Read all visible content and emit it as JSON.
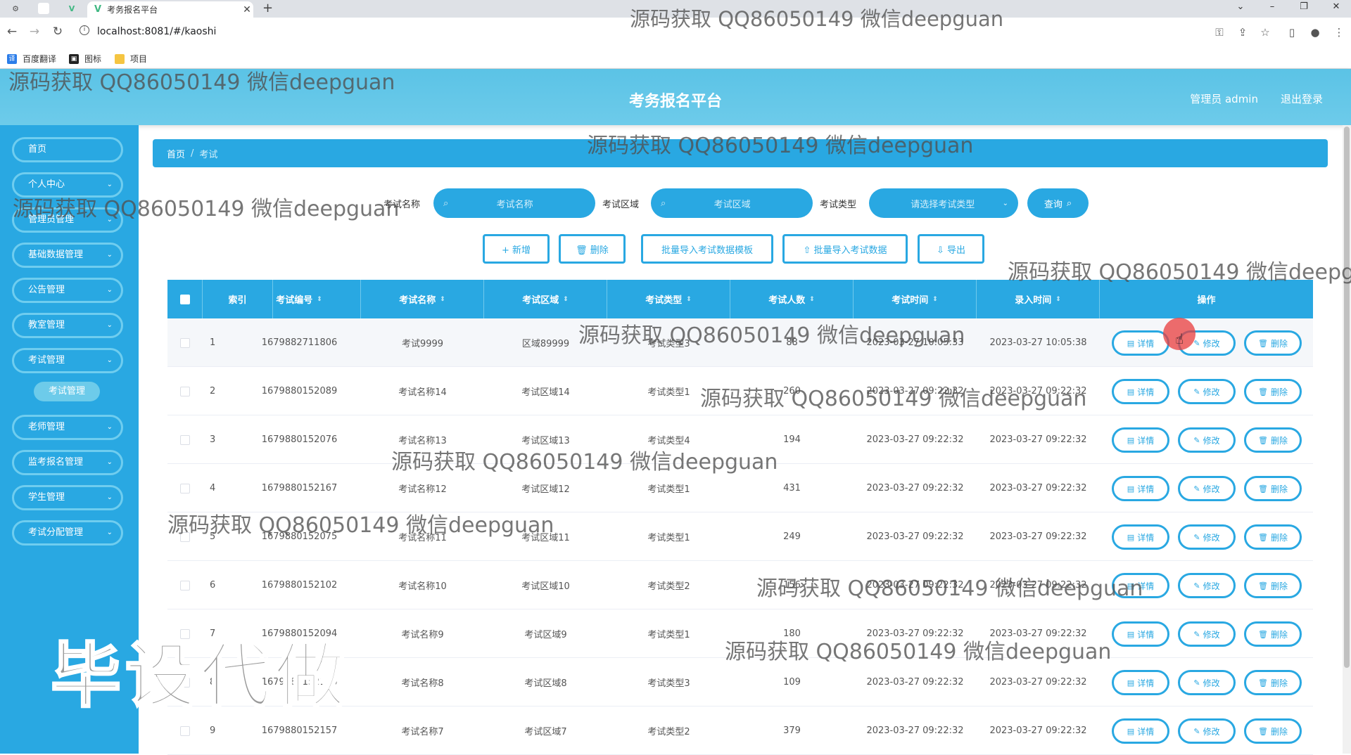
{
  "browser": {
    "tab_title": "考务报名平台",
    "tab_close": "✕",
    "new_tab": "+",
    "url": "localhost:8081/#/kaoshi",
    "bookmarks": [
      "百度翻译",
      "图标",
      "项目"
    ]
  },
  "header": {
    "title": "考务报名平台",
    "user": "管理员 admin",
    "logout": "退出登录"
  },
  "sidebar": {
    "items": [
      {
        "label": "首页"
      },
      {
        "label": "个人中心"
      },
      {
        "label": "管理员管理"
      },
      {
        "label": "基础数据管理"
      },
      {
        "label": "公告管理"
      },
      {
        "label": "教室管理"
      },
      {
        "label": "考试管理"
      },
      {
        "label": "老师管理"
      },
      {
        "label": "监考报名管理"
      },
      {
        "label": "学生管理"
      },
      {
        "label": "考试分配管理"
      }
    ],
    "subitem": "考试管理",
    "chevron": "⌄"
  },
  "breadcrumb": {
    "home": "首页",
    "sep": "/",
    "current": "考试"
  },
  "search": {
    "name_label": "考试名称",
    "name_placeholder": "考试名称",
    "area_label": "考试区域",
    "area_placeholder": "考试区域",
    "type_label": "考试类型",
    "type_placeholder": "请选择考试类型",
    "query": "查询"
  },
  "actions": {
    "add": "+ 新增",
    "delete": "🗑 删除",
    "import_template": "批量导入考试数据模板",
    "import_data": "⇧ 批量导入考试数据",
    "export": "⇩ 导出"
  },
  "table": {
    "headers": [
      "索引",
      "考试编号",
      "考试名称",
      "考试区域",
      "考试类型",
      "考试人数",
      "考试时间",
      "录入时间",
      "操作"
    ],
    "sort_icon": "⇕",
    "btn_detail": "详情",
    "btn_edit": "修改",
    "btn_delete": "删除",
    "rows": [
      {
        "idx": "1",
        "code": "1679882711806",
        "name": "考试9999",
        "area": "区域89999",
        "type": "考试类型3",
        "count": "88",
        "time": "2023-03-27 10:05:33",
        "created": "2023-03-27 10:05:38"
      },
      {
        "idx": "2",
        "code": "1679880152089",
        "name": "考试名称14",
        "area": "考试区域14",
        "type": "考试类型1",
        "count": "260",
        "time": "2023-03-27 09:22:32",
        "created": "2023-03-27 09:22:32"
      },
      {
        "idx": "3",
        "code": "1679880152076",
        "name": "考试名称13",
        "area": "考试区域13",
        "type": "考试类型4",
        "count": "194",
        "time": "2023-03-27 09:22:32",
        "created": "2023-03-27 09:22:32"
      },
      {
        "idx": "4",
        "code": "1679880152167",
        "name": "考试名称12",
        "area": "考试区域12",
        "type": "考试类型1",
        "count": "431",
        "time": "2023-03-27 09:22:32",
        "created": "2023-03-27 09:22:32"
      },
      {
        "idx": "5",
        "code": "1679880152075",
        "name": "考试名称11",
        "area": "考试区域11",
        "type": "考试类型1",
        "count": "249",
        "time": "2023-03-27 09:22:32",
        "created": "2023-03-27 09:22:32"
      },
      {
        "idx": "6",
        "code": "1679880152102",
        "name": "考试名称10",
        "area": "考试区域10",
        "type": "考试类型2",
        "count": "156",
        "time": "2023-03-27 09:22:32",
        "created": "2023-03-27 09:22:32"
      },
      {
        "idx": "7",
        "code": "1679880152094",
        "name": "考试名称9",
        "area": "考试区域9",
        "type": "考试类型1",
        "count": "180",
        "time": "2023-03-27 09:22:32",
        "created": "2023-03-27 09:22:32"
      },
      {
        "idx": "8",
        "code": "1679880152116",
        "name": "考试名称8",
        "area": "考试区域8",
        "type": "考试类型3",
        "count": "109",
        "time": "2023-03-27 09:22:32",
        "created": "2023-03-27 09:22:32"
      },
      {
        "idx": "9",
        "code": "1679880152157",
        "name": "考试名称7",
        "area": "考试区域7",
        "type": "考试类型2",
        "count": "379",
        "time": "2023-03-27 09:22:32",
        "created": "2023-03-27 09:22:32"
      }
    ]
  },
  "watermarks": {
    "text": "源码获取 QQ86050149 微信deepguan",
    "text_cut": "源码获取 QQ86050149 微信deepgu",
    "big": "毕设代做"
  },
  "colors": {
    "primary": "#29a8e2",
    "header": "#5bc3e6",
    "pill_border": "#6fcdef"
  }
}
